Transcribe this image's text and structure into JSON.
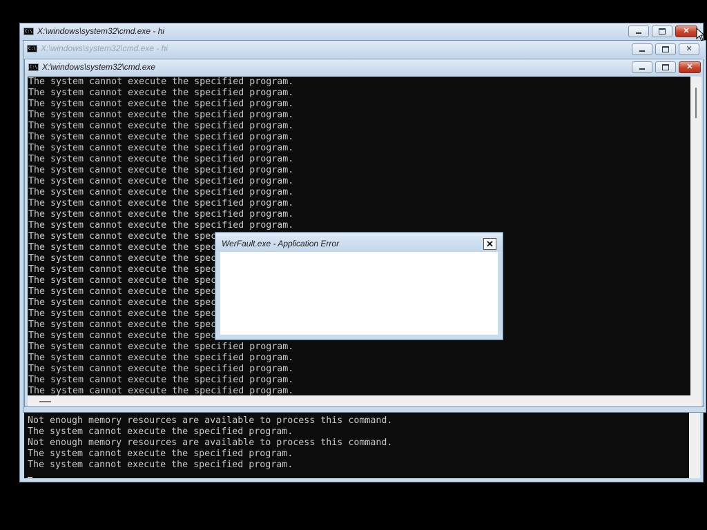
{
  "windows": {
    "back": {
      "title": "X:\\windows\\system32\\cmd.exe - hi",
      "icon": "cmd-icon",
      "close_glyph": "✕"
    },
    "middle": {
      "title": "X:\\windows\\system32\\cmd.exe - hi",
      "icon": "cmd-icon",
      "close_glyph": "✕"
    },
    "front": {
      "title": "X:\\windows\\system32\\cmd.exe",
      "icon": "cmd-icon",
      "close_glyph": "✕",
      "lines": [
        "The system cannot execute the specified program.",
        "The system cannot execute the specified program.",
        "The system cannot execute the specified program.",
        "The system cannot execute the specified program.",
        "The system cannot execute the specified program.",
        "The system cannot execute the specified program.",
        "The system cannot execute the specified program.",
        "The system cannot execute the specified program.",
        "The system cannot execute the specified program.",
        "The system cannot execute the specified program.",
        "The system cannot execute the specified program.",
        "The system cannot execute the specified program.",
        "The system cannot execute the specified program.",
        "The system cannot execute the specified program.",
        "The system cannot execute the specified program.",
        "The system cannot execute the specified program.",
        "The system cannot execute the specified program.",
        "The system cannot execute the specified program.",
        "The system cannot execute the specified program.",
        "The system cannot execute the specified program.",
        "The system cannot execute the specified program.",
        "The system cannot execute the specified program.",
        "The system cannot execute the specified program.",
        "The system cannot execute the specified program.",
        "The system cannot execute the specified program.",
        "The system cannot execute the specified program.",
        "The system cannot execute the specified program.",
        "The system cannot execute the specified program.",
        "The system cannot execute the specified program."
      ]
    },
    "bottom": {
      "lines": [
        "Not enough memory resources are available to process this command.",
        "The system cannot execute the specified program.",
        "Not enough memory resources are available to process this command.",
        "The system cannot execute the specified program.",
        "The system cannot execute the specified program."
      ]
    }
  },
  "dialog": {
    "title": "WerFault.exe - Application Error",
    "close_glyph": "✕"
  },
  "icons": {
    "minimize": "minimize-icon",
    "maximize": "maximize-icon",
    "close": "close-icon",
    "pointer": "mouse-pointer-icon"
  },
  "colors": {
    "console_bg": "#0c0c0c",
    "console_text": "#c8c8c8",
    "close_button": "#c7432b",
    "titlebar": "#c9dcee"
  }
}
